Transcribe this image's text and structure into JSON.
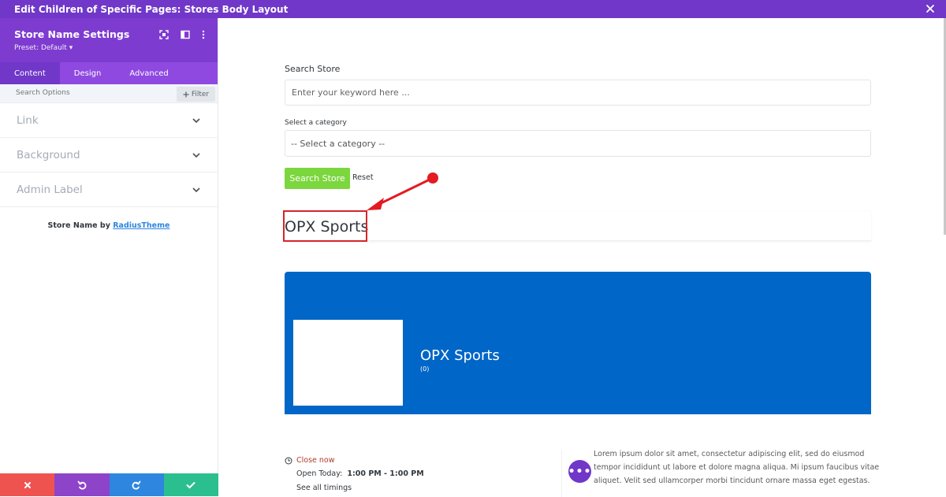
{
  "window": {
    "title": "Edit Children of Specific Pages: Stores Body Layout"
  },
  "panel": {
    "title": "Store Name Settings",
    "preset": "Preset: Default ▾",
    "tabs": [
      {
        "label": "Content"
      },
      {
        "label": "Design"
      },
      {
        "label": "Advanced"
      }
    ],
    "search_placeholder": "Search Options",
    "filter_label": "Filter",
    "groups": [
      {
        "label": "Link"
      },
      {
        "label": "Background"
      },
      {
        "label": "Admin Label"
      }
    ],
    "credit_prefix": "Store Name by ",
    "credit_link": "RadiusTheme"
  },
  "colors": {
    "accent": "#7037c8",
    "button_green": "#7cd63d",
    "banner_blue": "#0066c7",
    "annotation_red": "#d6242b",
    "bottombar": [
      "#ef5350",
      "#8e44c9",
      "#2e86de",
      "#2bbf8f"
    ]
  },
  "bottombar": {
    "icons": [
      "close-icon",
      "undo-icon",
      "redo-icon",
      "check-icon"
    ]
  },
  "main": {
    "search_label": "Search Store",
    "keyword_placeholder": "Enter your keyword here ...",
    "category_label": "Select a category",
    "category_value": "-- Select a category --",
    "search_button": "Search Store",
    "reset_link": "Reset",
    "store_title": "OPX Sports",
    "banner": {
      "name": "OPX Sports",
      "count": "(0)"
    },
    "hours": {
      "status": "Close now",
      "open_today_label": "Open Today:",
      "open_today_value": "1:00 PM  - 1:00 PM",
      "see_all": "See all timings"
    },
    "description": "Lorem ipsum dolor sit amet, consectetur adipiscing elit, sed do eiusmod tempor incididunt ut labore et dolore magna aliqua. Mi ipsum faucibus vitae aliquet. Velit sed ullamcorper morbi tincidunt ornare massa eget egestas."
  }
}
